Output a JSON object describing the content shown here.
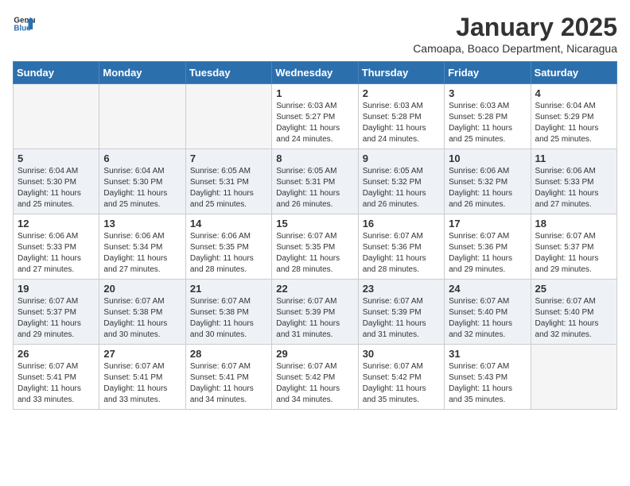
{
  "logo": {
    "line1": "General",
    "line2": "Blue"
  },
  "title": "January 2025",
  "subtitle": "Camoapa, Boaco Department, Nicaragua",
  "weekdays": [
    "Sunday",
    "Monday",
    "Tuesday",
    "Wednesday",
    "Thursday",
    "Friday",
    "Saturday"
  ],
  "weeks": [
    [
      {
        "day": "",
        "info": ""
      },
      {
        "day": "",
        "info": ""
      },
      {
        "day": "",
        "info": ""
      },
      {
        "day": "1",
        "info": "Sunrise: 6:03 AM\nSunset: 5:27 PM\nDaylight: 11 hours and 24 minutes."
      },
      {
        "day": "2",
        "info": "Sunrise: 6:03 AM\nSunset: 5:28 PM\nDaylight: 11 hours and 24 minutes."
      },
      {
        "day": "3",
        "info": "Sunrise: 6:03 AM\nSunset: 5:28 PM\nDaylight: 11 hours and 25 minutes."
      },
      {
        "day": "4",
        "info": "Sunrise: 6:04 AM\nSunset: 5:29 PM\nDaylight: 11 hours and 25 minutes."
      }
    ],
    [
      {
        "day": "5",
        "info": "Sunrise: 6:04 AM\nSunset: 5:30 PM\nDaylight: 11 hours and 25 minutes."
      },
      {
        "day": "6",
        "info": "Sunrise: 6:04 AM\nSunset: 5:30 PM\nDaylight: 11 hours and 25 minutes."
      },
      {
        "day": "7",
        "info": "Sunrise: 6:05 AM\nSunset: 5:31 PM\nDaylight: 11 hours and 25 minutes."
      },
      {
        "day": "8",
        "info": "Sunrise: 6:05 AM\nSunset: 5:31 PM\nDaylight: 11 hours and 26 minutes."
      },
      {
        "day": "9",
        "info": "Sunrise: 6:05 AM\nSunset: 5:32 PM\nDaylight: 11 hours and 26 minutes."
      },
      {
        "day": "10",
        "info": "Sunrise: 6:06 AM\nSunset: 5:32 PM\nDaylight: 11 hours and 26 minutes."
      },
      {
        "day": "11",
        "info": "Sunrise: 6:06 AM\nSunset: 5:33 PM\nDaylight: 11 hours and 27 minutes."
      }
    ],
    [
      {
        "day": "12",
        "info": "Sunrise: 6:06 AM\nSunset: 5:33 PM\nDaylight: 11 hours and 27 minutes."
      },
      {
        "day": "13",
        "info": "Sunrise: 6:06 AM\nSunset: 5:34 PM\nDaylight: 11 hours and 27 minutes."
      },
      {
        "day": "14",
        "info": "Sunrise: 6:06 AM\nSunset: 5:35 PM\nDaylight: 11 hours and 28 minutes."
      },
      {
        "day": "15",
        "info": "Sunrise: 6:07 AM\nSunset: 5:35 PM\nDaylight: 11 hours and 28 minutes."
      },
      {
        "day": "16",
        "info": "Sunrise: 6:07 AM\nSunset: 5:36 PM\nDaylight: 11 hours and 28 minutes."
      },
      {
        "day": "17",
        "info": "Sunrise: 6:07 AM\nSunset: 5:36 PM\nDaylight: 11 hours and 29 minutes."
      },
      {
        "day": "18",
        "info": "Sunrise: 6:07 AM\nSunset: 5:37 PM\nDaylight: 11 hours and 29 minutes."
      }
    ],
    [
      {
        "day": "19",
        "info": "Sunrise: 6:07 AM\nSunset: 5:37 PM\nDaylight: 11 hours and 29 minutes."
      },
      {
        "day": "20",
        "info": "Sunrise: 6:07 AM\nSunset: 5:38 PM\nDaylight: 11 hours and 30 minutes."
      },
      {
        "day": "21",
        "info": "Sunrise: 6:07 AM\nSunset: 5:38 PM\nDaylight: 11 hours and 30 minutes."
      },
      {
        "day": "22",
        "info": "Sunrise: 6:07 AM\nSunset: 5:39 PM\nDaylight: 11 hours and 31 minutes."
      },
      {
        "day": "23",
        "info": "Sunrise: 6:07 AM\nSunset: 5:39 PM\nDaylight: 11 hours and 31 minutes."
      },
      {
        "day": "24",
        "info": "Sunrise: 6:07 AM\nSunset: 5:40 PM\nDaylight: 11 hours and 32 minutes."
      },
      {
        "day": "25",
        "info": "Sunrise: 6:07 AM\nSunset: 5:40 PM\nDaylight: 11 hours and 32 minutes."
      }
    ],
    [
      {
        "day": "26",
        "info": "Sunrise: 6:07 AM\nSunset: 5:41 PM\nDaylight: 11 hours and 33 minutes."
      },
      {
        "day": "27",
        "info": "Sunrise: 6:07 AM\nSunset: 5:41 PM\nDaylight: 11 hours and 33 minutes."
      },
      {
        "day": "28",
        "info": "Sunrise: 6:07 AM\nSunset: 5:41 PM\nDaylight: 11 hours and 34 minutes."
      },
      {
        "day": "29",
        "info": "Sunrise: 6:07 AM\nSunset: 5:42 PM\nDaylight: 11 hours and 34 minutes."
      },
      {
        "day": "30",
        "info": "Sunrise: 6:07 AM\nSunset: 5:42 PM\nDaylight: 11 hours and 35 minutes."
      },
      {
        "day": "31",
        "info": "Sunrise: 6:07 AM\nSunset: 5:43 PM\nDaylight: 11 hours and 35 minutes."
      },
      {
        "day": "",
        "info": ""
      }
    ]
  ]
}
